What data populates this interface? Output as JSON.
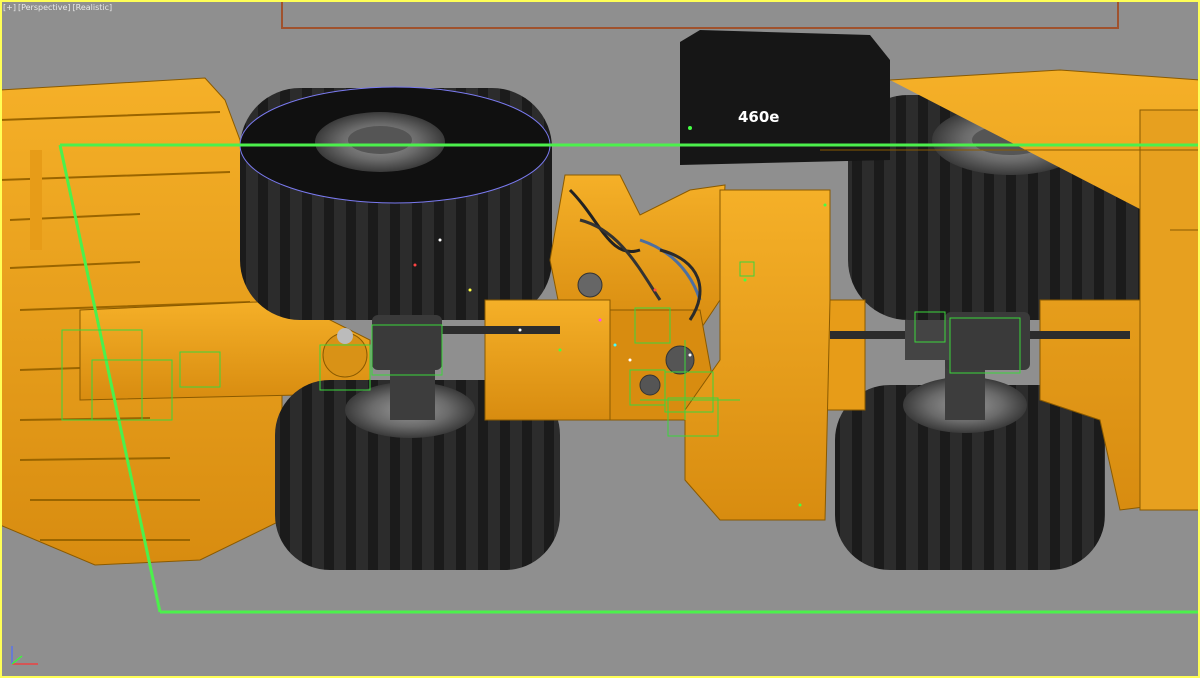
{
  "viewport": {
    "labels": [
      "[+]",
      "[Perspective]",
      "[Realistic]"
    ],
    "border_color": "#ffff56",
    "background_color": "#8f8f8f"
  },
  "model": {
    "badge_text": "460e",
    "body_color": "#f0a419",
    "tire_color": "#1b1b1b",
    "selection_color": "#4cf04c"
  },
  "axis": {
    "x_color": "#ff3333",
    "y_color": "#33ff33",
    "z_color": "#4f6cff"
  }
}
